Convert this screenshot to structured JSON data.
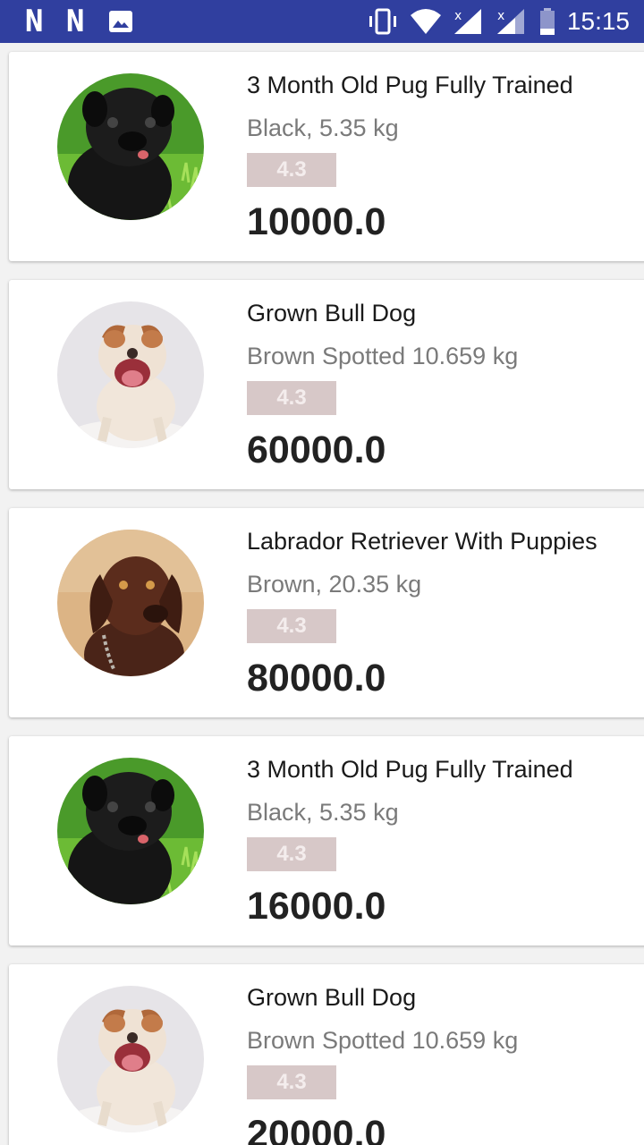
{
  "status_bar": {
    "time": "15:15",
    "left_icons": [
      "n-app-icon",
      "n-app-icon",
      "image-icon"
    ],
    "right_icons": [
      "vibrate-icon",
      "wifi-icon",
      "signal-x-icon",
      "signal-x-icon",
      "battery-icon"
    ],
    "color": "#303f9f"
  },
  "items": [
    {
      "title": "3 Month Old Pug Fully Trained",
      "description": " Black, 5.35 kg",
      "rating": "4.3",
      "price": "10000.0",
      "image": "black-pug-photo"
    },
    {
      "title": "Grown Bull Dog",
      "description": "Brown Spotted 10.659 kg",
      "rating": "4.3",
      "price": "60000.0",
      "image": "bulldog-photo"
    },
    {
      "title": "Labrador Retriever With Puppies",
      "description": "Brown, 20.35 kg",
      "rating": "4.3",
      "price": "80000.0",
      "image": "labrador-photo"
    },
    {
      "title": "3 Month Old Pug Fully Trained",
      "description": "Black, 5.35 kg",
      "rating": "4.3",
      "price": "16000.0",
      "image": "black-pug-photo"
    },
    {
      "title": "Grown Bull Dog",
      "description": "Brown Spotted 10.659 kg",
      "rating": "4.3",
      "price": "20000.0",
      "image": "bulldog-photo"
    }
  ]
}
